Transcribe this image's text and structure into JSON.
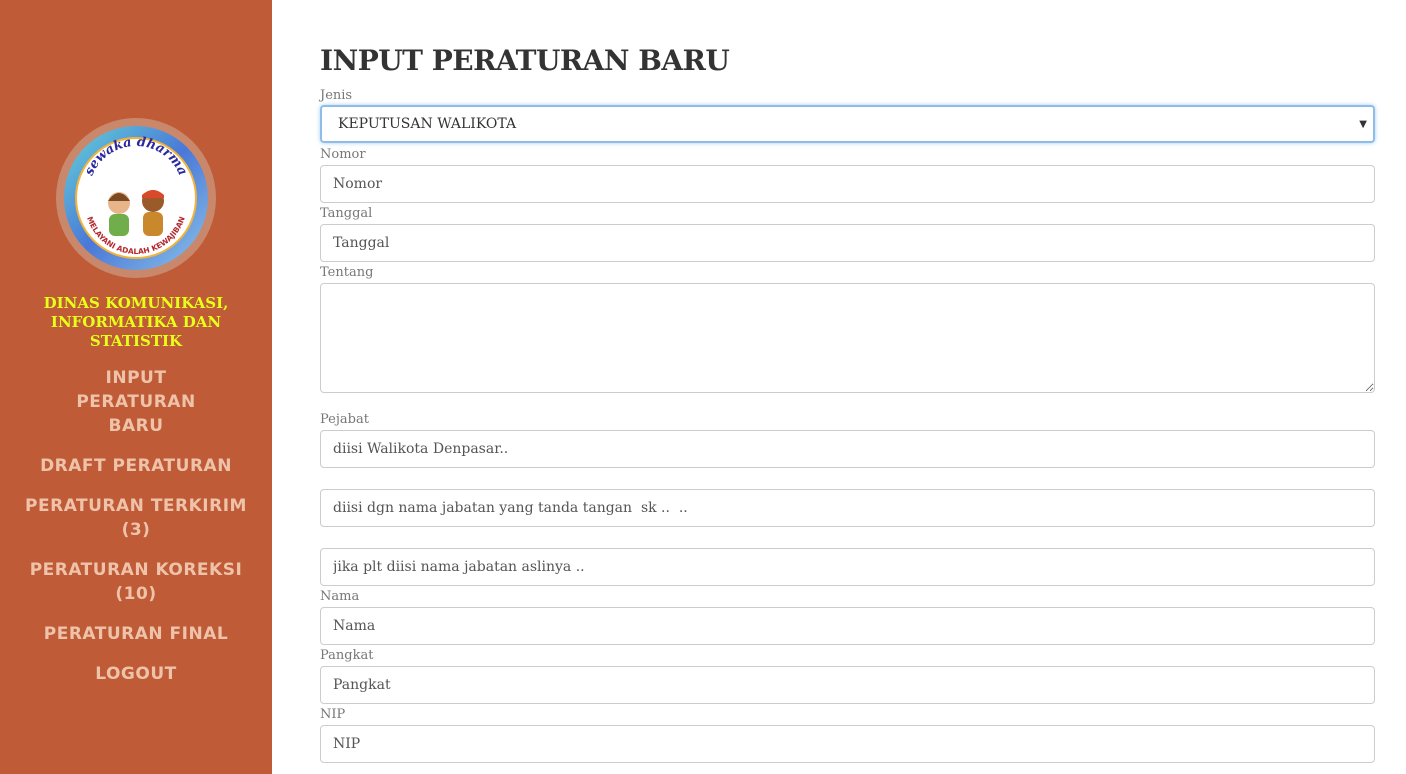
{
  "sidebar": {
    "logo": {
      "icon": "sewaka-dharma-logo",
      "top_text": "sewaka dharma",
      "bottom_text": "MELAYANI ADALAH KEWAJIBAN"
    },
    "org_name": "DINAS KOMUNIKASI, INFORMATIKA DAN STATISTIK",
    "nav": [
      {
        "label": "INPUT PERATURAN BARU"
      },
      {
        "label": "DRAFT PERATURAN"
      },
      {
        "label": "PERATURAN TERKIRIM (3)"
      },
      {
        "label": "PERATURAN KOREKSI (10)"
      },
      {
        "label": "PERATURAN FINAL"
      },
      {
        "label": "LOGOUT"
      }
    ]
  },
  "form": {
    "title": "INPUT PERATURAN BARU",
    "jenis": {
      "label": "Jenis",
      "value": "KEPUTUSAN WALIKOTA"
    },
    "nomor": {
      "label": "Nomor",
      "placeholder": "Nomor"
    },
    "tanggal": {
      "label": "Tanggal",
      "placeholder": "Tanggal"
    },
    "tentang": {
      "label": "Tentang",
      "placeholder": ""
    },
    "pejabat": {
      "label": "Pejabat",
      "placeholder1": "diisi Walikota Denpasar..",
      "placeholder2": "diisi dgn nama jabatan yang tanda tangan  sk ..  ..",
      "placeholder3": "jika plt diisi nama jabatan aslinya .."
    },
    "nama": {
      "label": "Nama",
      "placeholder": "Nama"
    },
    "pangkat": {
      "label": "Pangkat",
      "placeholder": "Pangkat"
    },
    "nip": {
      "label": "NIP",
      "placeholder": "NIP"
    }
  },
  "colors": {
    "sidebar_bg": "#bf5b37",
    "org_name": "#e6ff1a",
    "nav_text": "#eec3a9"
  }
}
